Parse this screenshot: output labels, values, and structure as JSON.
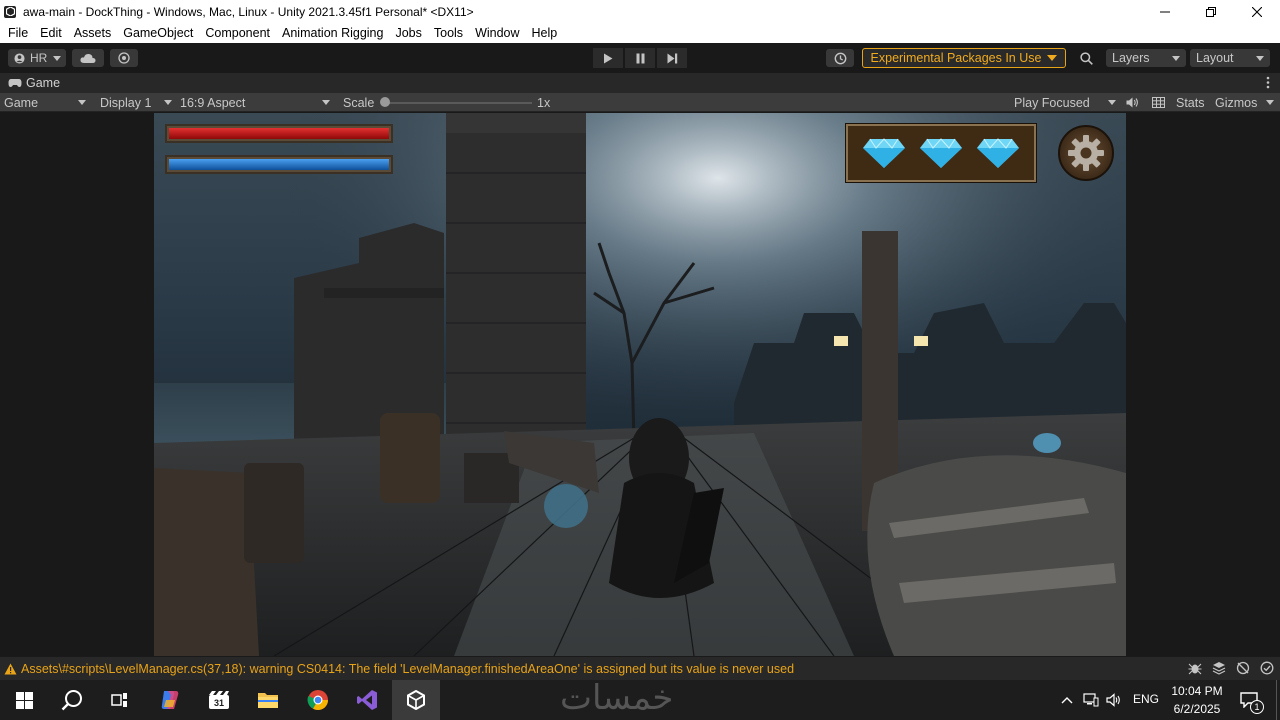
{
  "window": {
    "title": "awa-main - DockThing - Windows, Mac, Linux - Unity 2021.3.45f1 Personal* <DX11>"
  },
  "menu": [
    "File",
    "Edit",
    "Assets",
    "GameObject",
    "Component",
    "Animation Rigging",
    "Jobs",
    "Tools",
    "Window",
    "Help"
  ],
  "toolbar": {
    "account_label": "HR",
    "experimental_label": "Experimental Packages In Use",
    "layers_label": "Layers",
    "layout_label": "Layout"
  },
  "game_tab": {
    "label": "Game"
  },
  "game_controls": {
    "view_mode": "Game",
    "display": "Display 1",
    "aspect": "16:9 Aspect",
    "scale_label": "Scale",
    "scale_value": "1x",
    "play_mode": "Play Focused",
    "stats_label": "Stats",
    "gizmos_label": "Gizmos"
  },
  "hud": {
    "health_fraction": 1.0,
    "mana_fraction": 1.0,
    "gems_count": 3
  },
  "console": {
    "message": "Assets\\#scripts\\LevelManager.cs(37,18): warning CS0414: The field 'LevelManager.finishedAreaOne' is assigned but its value is never used"
  },
  "taskbar": {
    "watermark": "خمسات",
    "language": "ENG",
    "time": "10:04 PM",
    "date": "6/2/2025",
    "notifications": "1"
  },
  "colors": {
    "warning": "#e8a317",
    "health": "#c81010",
    "mana": "#1a6fc8"
  }
}
